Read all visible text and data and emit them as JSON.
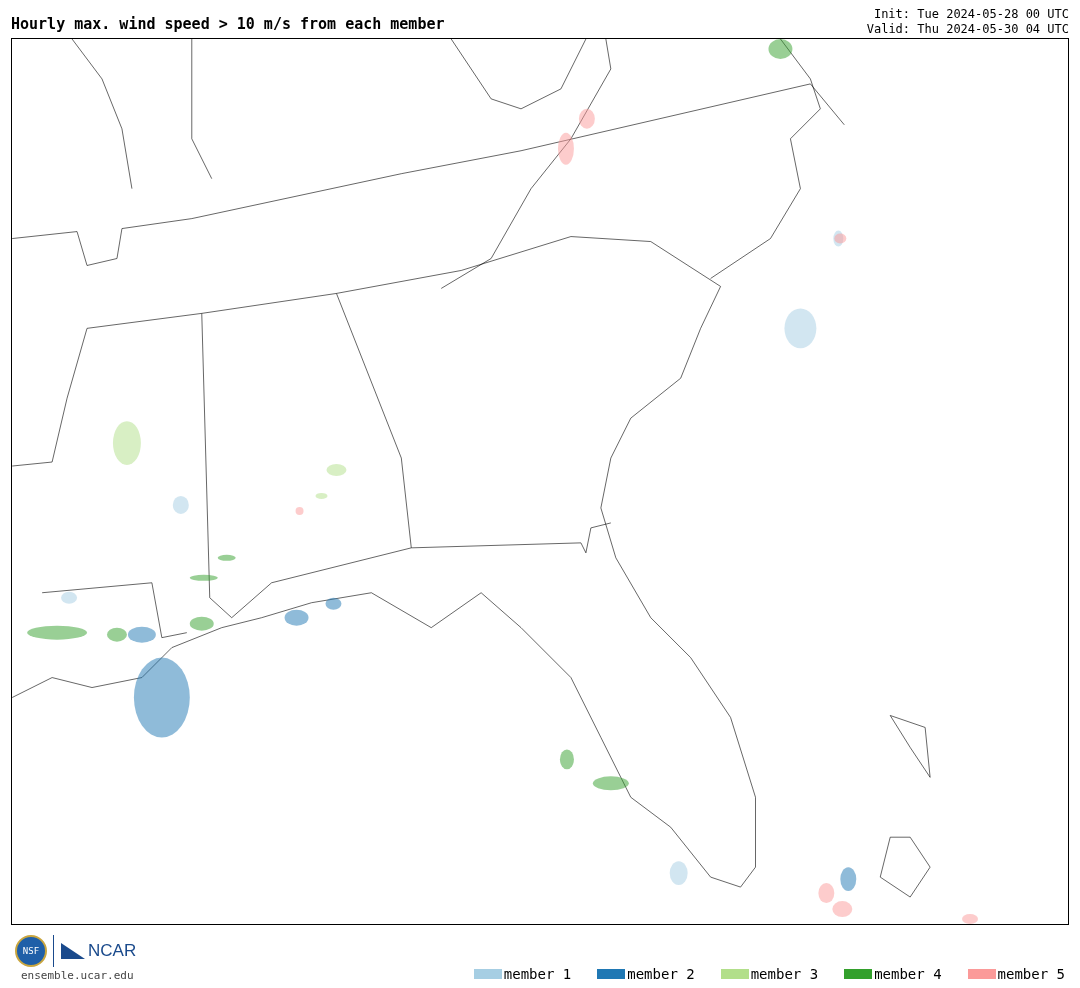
{
  "header": {
    "title": "Hourly max. wind speed > 10 m/s from each member",
    "init": "Init: Tue 2024-05-28 00 UTC",
    "valid": "Valid: Thu 2024-05-30 04 UTC"
  },
  "footer": {
    "nsf_logo_text": "NSF",
    "ncar_logo_text": "NCAR",
    "url": "ensemble.ucar.edu"
  },
  "legend": [
    {
      "label": "member 1",
      "color": "#a6cee3"
    },
    {
      "label": "member 2",
      "color": "#1f78b4"
    },
    {
      "label": "member 3",
      "color": "#b2df8a"
    },
    {
      "label": "member 4",
      "color": "#33a02c"
    },
    {
      "label": "member 5",
      "color": "#fb9a99"
    }
  ]
}
